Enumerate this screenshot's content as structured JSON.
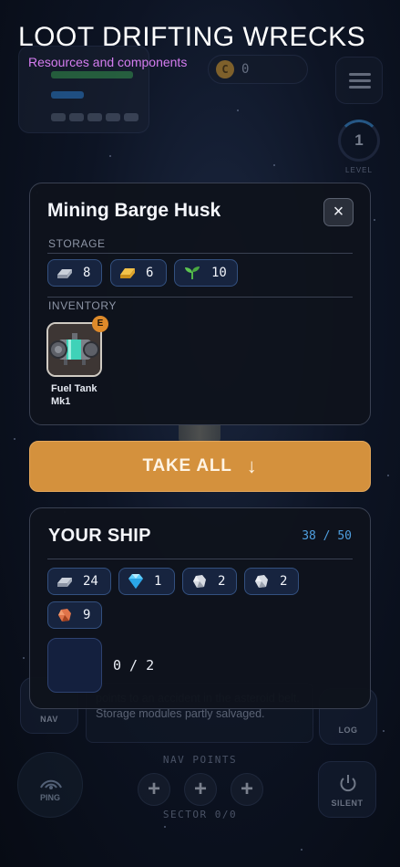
{
  "header": {
    "title": "LOOT DRIFTING WRECKS",
    "subtitle": "Resources and components"
  },
  "hud": {
    "credits": "0",
    "level": "1",
    "level_label": "LEVEL"
  },
  "wreck": {
    "title": "Mining Barge Husk",
    "close_label": "×",
    "storage_label": "STORAGE",
    "inventory_label": "INVENTORY",
    "storage": [
      {
        "icon": "metal-ingot-icon",
        "count": "8"
      },
      {
        "icon": "gold-ore-icon",
        "count": "6"
      },
      {
        "icon": "sprout-icon",
        "count": "10"
      }
    ],
    "inventory": [
      {
        "icon": "fuel-tank-icon",
        "badge": "E",
        "name": "Fuel Tank Mk1"
      }
    ]
  },
  "take_all": {
    "label": "TAKE ALL",
    "arrow": "↓"
  },
  "ship": {
    "title": "YOUR SHIP",
    "capacity": "38 / 50",
    "resources": [
      {
        "icon": "metal-ingot-icon",
        "count": "24"
      },
      {
        "icon": "diamond-icon",
        "count": "1"
      },
      {
        "icon": "silver-ore-icon",
        "count": "2"
      },
      {
        "icon": "silver-ore-icon",
        "count": "2"
      },
      {
        "icon": "copper-ore-icon",
        "count": "9"
      }
    ],
    "slot_count": "0 / 2"
  },
  "background": {
    "description": "points to an accident in the asteroid belt. Storage modules partly salvaged.",
    "nav_label": "NAV",
    "log_label": "LOG",
    "ping_label": "PING",
    "silent_label": "SILENT",
    "nav_points_label": "NAV POINTS",
    "sector_label": "SECTOR 0/0",
    "plus": "+"
  },
  "colors": {
    "accent_orange": "#d4913d",
    "accent_blue": "#4f9fe0",
    "subtitle_purple": "#d57df0",
    "badge_orange": "#de8a2a"
  }
}
